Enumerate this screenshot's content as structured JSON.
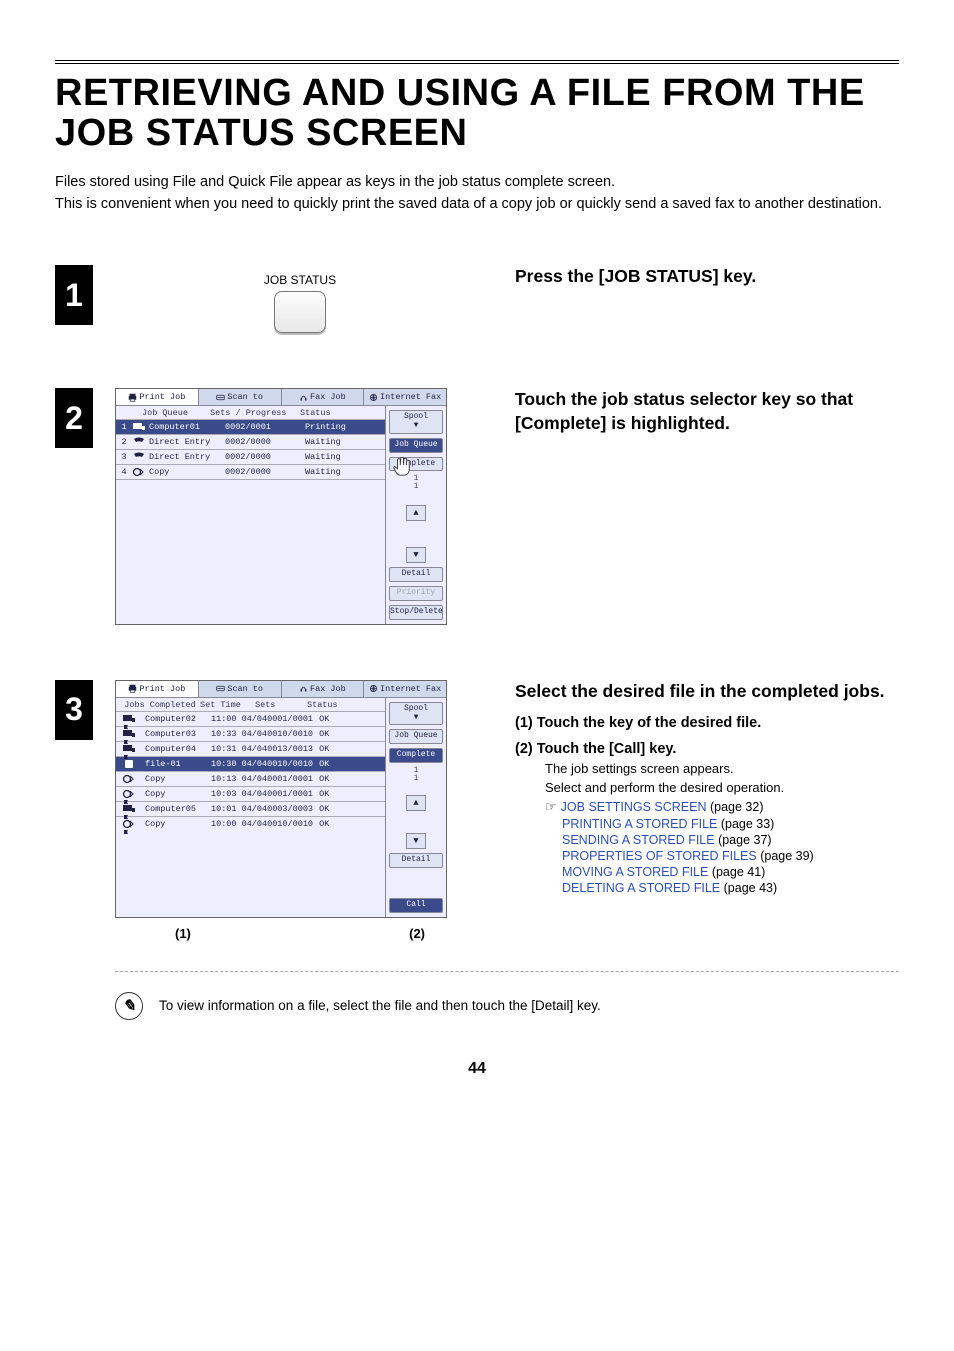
{
  "title": "RETRIEVING AND USING A FILE FROM THE JOB STATUS SCREEN",
  "intro": "Files stored using File and Quick File appear as keys in the job status complete screen.\nThis is convenient when you need to quickly print the saved data of a copy job or quickly send a saved fax to another destination.",
  "page_number": "44",
  "step1": {
    "num": "1",
    "key_label": "JOB STATUS",
    "instruction": "Press the [JOB STATUS] key."
  },
  "step2": {
    "num": "2",
    "instruction": "Touch the job status selector key so that [Complete] is highlighted.",
    "screen": {
      "tabs": [
        "Print Job",
        "Scan to",
        "Fax Job",
        "Internet Fax"
      ],
      "list_head_a": "Job Queue",
      "list_head_b": "Sets / Progress",
      "list_head_c": "Status",
      "rows": [
        {
          "n": "1",
          "name": "Computer01",
          "prog": "0002/0001",
          "stat": "Printing",
          "hl": true,
          "icon": "pc"
        },
        {
          "n": "2",
          "name": "Direct Entry",
          "prog": "0002/0000",
          "stat": "Waiting",
          "hl": false,
          "icon": "phone"
        },
        {
          "n": "3",
          "name": "Direct Entry",
          "prog": "0002/0000",
          "stat": "Waiting",
          "hl": false,
          "icon": "phone"
        },
        {
          "n": "4",
          "name": "Copy",
          "prog": "0002/0000",
          "stat": "Waiting",
          "hl": false,
          "icon": "copy"
        }
      ],
      "side": {
        "spool": "Spool",
        "jobqueue": "Job Queue",
        "complete": "Complete",
        "page": "1",
        "total": "1",
        "detail": "Detail",
        "priority": "Priority",
        "stopdel": "Stop/Delete"
      }
    }
  },
  "step3": {
    "num": "3",
    "title": "Select the desired file in the completed jobs.",
    "sub1": "(1)  Touch the key of the desired file.",
    "sub2": "(2)  Touch the [Call] key.",
    "body1": "The job settings screen appears.",
    "body2": "Select and perform the desired operation.",
    "links": [
      {
        "t": "JOB SETTINGS SCREEN",
        "p": "(page 32)"
      },
      {
        "t": "PRINTING A STORED FILE",
        "p": "(page 33)"
      },
      {
        "t": "SENDING A STORED FILE",
        "p": "(page 37)"
      },
      {
        "t": "PROPERTIES OF STORED FILES",
        "p": "(page 39)"
      },
      {
        "t": "MOVING A STORED FILE",
        "p": "(page 41)"
      },
      {
        "t": "DELETING A STORED FILE",
        "p": "(page 43)"
      }
    ],
    "callout1": "(1)",
    "callout2": "(2)",
    "screen": {
      "tabs": [
        "Print Job",
        "Scan to",
        "Fax Job",
        "Internet Fax"
      ],
      "list_head_a": "Jobs Completed",
      "list_head_b": "Set Time",
      "list_head_b2": "Sets",
      "list_head_c": "Status",
      "rows": [
        {
          "name": "Computer02",
          "time": "11:00 04/04",
          "sets": "0001/0001",
          "stat": "OK",
          "icon": "pcf"
        },
        {
          "name": "Computer03",
          "time": "10:33 04/04",
          "sets": "0010/0010",
          "stat": "OK",
          "icon": "pcf"
        },
        {
          "name": "Computer04",
          "time": "10:31 04/04",
          "sets": "0013/0013",
          "stat": "OK",
          "icon": "pcf"
        },
        {
          "name": "file-01",
          "time": "10:30 04/04",
          "sets": "0010/0010",
          "stat": "OK",
          "icon": "file",
          "hl": true
        },
        {
          "name": "Copy",
          "time": "10:13 04/04",
          "sets": "0001/0001",
          "stat": "OK",
          "icon": "copy"
        },
        {
          "name": "Copy",
          "time": "10:03 04/04",
          "sets": "0001/0001",
          "stat": "OK",
          "icon": "copyf"
        },
        {
          "name": "Computer05",
          "time": "10:01 04/04",
          "sets": "0003/0003",
          "stat": "OK",
          "icon": "pcf"
        },
        {
          "name": "Copy",
          "time": "10:00 04/04",
          "sets": "0010/0010",
          "stat": "OK",
          "icon": "copyf"
        }
      ],
      "side": {
        "spool": "Spool",
        "jobqueue": "Job Queue",
        "complete": "Complete",
        "page": "1",
        "total": "1",
        "detail": "Detail",
        "call": "Call"
      }
    }
  },
  "note": "To view information on a file, select the file and then touch the [Detail] key."
}
